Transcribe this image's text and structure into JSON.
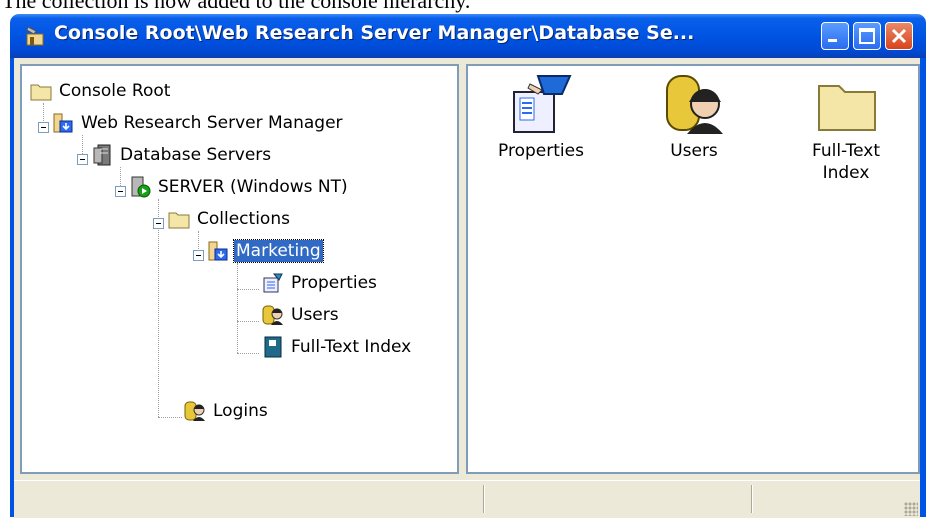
{
  "caption": "The collection is now added to the console hierarchy.",
  "window": {
    "title": "Console Root\\Web Research Server Manager\\Database Se...",
    "buttons": {
      "minimize": "minimize",
      "maximize": "maximize",
      "close": "close"
    }
  },
  "tree": {
    "console_root": "Console Root",
    "web_research": "Web Research Server Manager",
    "database_servers": "Database Servers",
    "server": "SERVER (Windows NT)",
    "collections": "Collections",
    "marketing": "Marketing",
    "properties": "Properties",
    "users": "Users",
    "fulltext": "Full-Text Index",
    "logins": "Logins"
  },
  "details": {
    "items": [
      {
        "label": "Properties",
        "icon": "properties-icon"
      },
      {
        "label": "Users",
        "icon": "users-icon"
      },
      {
        "label": "Full-Text\nIndex",
        "icon": "folder-icon"
      }
    ]
  },
  "colors": {
    "titlebar": "#0054e3",
    "selection": "#316ac5",
    "face": "#ece9d8"
  }
}
